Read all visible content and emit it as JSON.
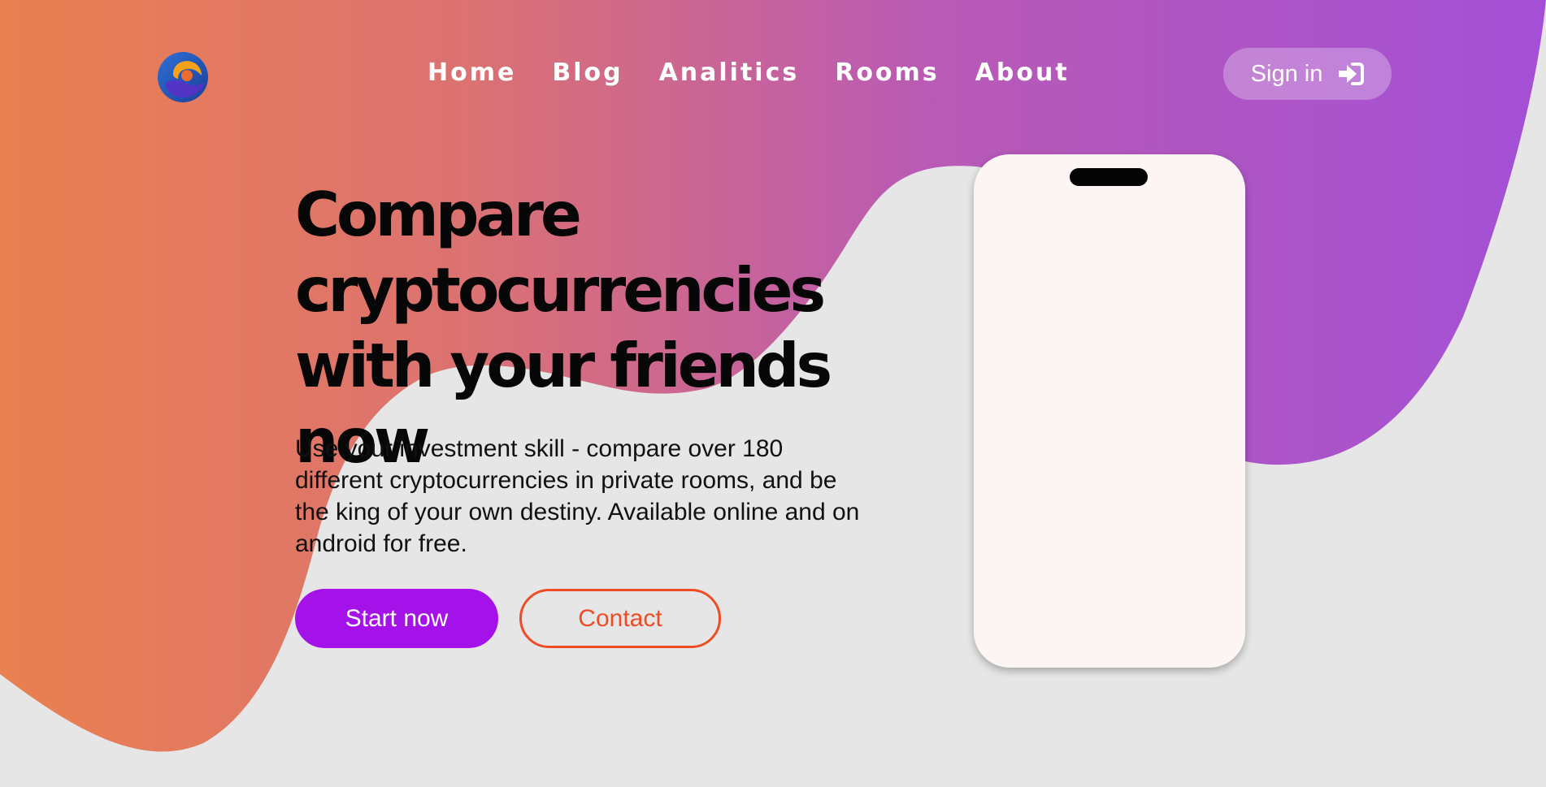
{
  "colors": {
    "gradient_start": "#e98050",
    "gradient_end": "#a350d6",
    "background": "#e6e6e6",
    "primary_button": "#a511e9",
    "contact_accent": "#ef4b24",
    "phone_screen": "#fdf5f3"
  },
  "logo": {
    "icon": "crescent-logo-icon"
  },
  "nav": {
    "items": [
      {
        "label": "Home"
      },
      {
        "label": "Blog"
      },
      {
        "label": "Analitics"
      },
      {
        "label": "Rooms"
      },
      {
        "label": "About"
      }
    ]
  },
  "header": {
    "sign_in_label": "Sign in",
    "sign_in_icon": "sign-in-arrow-icon"
  },
  "hero": {
    "title": "Compare cryptocurrencies with your friends now",
    "description": "Use your investment skill - compare over 180 different cryptocurrencies in private rooms, and be the king of your own destiny. Available online and on android for free.",
    "primary_button": "Start now",
    "secondary_button": "Contact"
  }
}
